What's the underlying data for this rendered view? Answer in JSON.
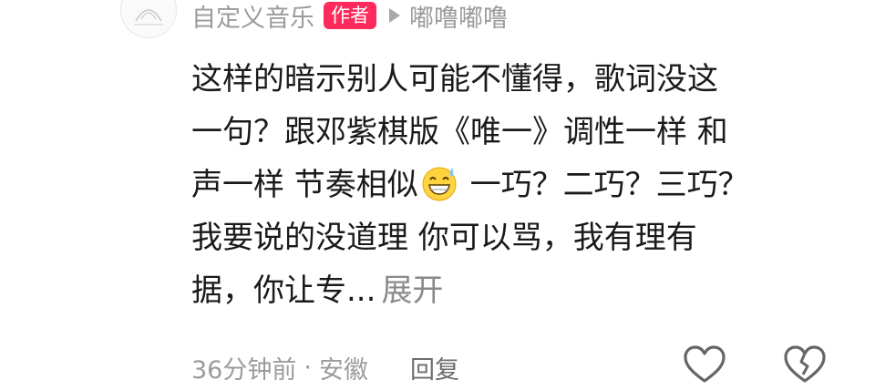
{
  "comment": {
    "username": "自定义音乐",
    "author_badge": "作者",
    "reply_to": "嘟噜嘟噜",
    "lines": [
      "这样的暗示别人可能不懂得，歌词没这",
      "一句？跟邓紫棋版《唯一》调性一样 和",
      "声一样 节奏相似",
      " 一巧？二巧？三巧？",
      "我要说的没道理 你可以骂，我有理有",
      "据，你让专..."
    ],
    "expand_label": "展开",
    "timestamp": "36分钟前",
    "separator": "·",
    "location": "安徽",
    "reply_label": "回复"
  },
  "icons": {
    "avatar": "music-logo-avatar",
    "reply_arrow": "play-arrow-icon",
    "emoji": "sweat-grin-emoji",
    "like": "heart-outline-icon",
    "dislike": "broken-heart-icon"
  },
  "colors": {
    "badge": "#ff2a5c",
    "meta_text": "#9b9b9b",
    "body_text": "#1a1a1a"
  }
}
